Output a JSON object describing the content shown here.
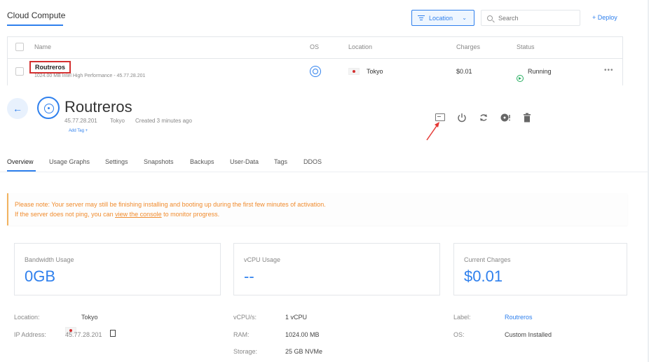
{
  "header": {
    "title": "Cloud Compute",
    "location_filter_label": "Location",
    "search_placeholder": "Search",
    "deploy_label": "+ Deploy"
  },
  "table": {
    "columns": [
      "Name",
      "OS",
      "Location",
      "Charges",
      "Status"
    ],
    "rows": [
      {
        "name": "Routreros",
        "subtitle": "1024.00 MB Intel High Performance - 45.77.28.201",
        "location": "Tokyo",
        "charges": "$0.01",
        "status": "Running"
      }
    ],
    "more_label": "•••"
  },
  "server": {
    "back_label": "←",
    "title": "Routreros",
    "ip": "45.77.28.201",
    "location": "Tokyo",
    "created": "Created 3 minutes ago",
    "add_tag": "Add Tag +"
  },
  "tabs": [
    "Overview",
    "Usage Graphs",
    "Settings",
    "Snapshots",
    "Backups",
    "User-Data",
    "Tags",
    "DDOS"
  ],
  "notice": {
    "line1": "Please note: Your server may still be finishing installing and booting up during the first few minutes of activation.",
    "line2_prefix": "If the server does not ping, you can ",
    "line2_link": "view the console",
    "line2_suffix": " to monitor progress."
  },
  "cards": [
    {
      "label": "Bandwidth Usage",
      "value": "0GB"
    },
    {
      "label": "vCPU Usage",
      "value": "--"
    },
    {
      "label": "Current Charges",
      "value": "$0.01"
    }
  ],
  "info": {
    "location_label": "Location:",
    "location_value": "Tokyo",
    "ip_label": "IP Address:",
    "ip_value": "45.77.28.201",
    "vcpu_label": "vCPU/s:",
    "vcpu_value": "1 vCPU",
    "ram_label": "RAM:",
    "ram_value": "1024.00 MB",
    "storage_label": "Storage:",
    "storage_value": "25 GB NVMe",
    "label_label": "Label:",
    "label_value": "Routreros",
    "os_label": "OS:",
    "os_value": "Custom Installed"
  },
  "colors": {
    "accent": "#2f80ed",
    "highlight_box": "#d32f2f",
    "running": "#27ae60",
    "notice_text": "#f08b2d"
  }
}
